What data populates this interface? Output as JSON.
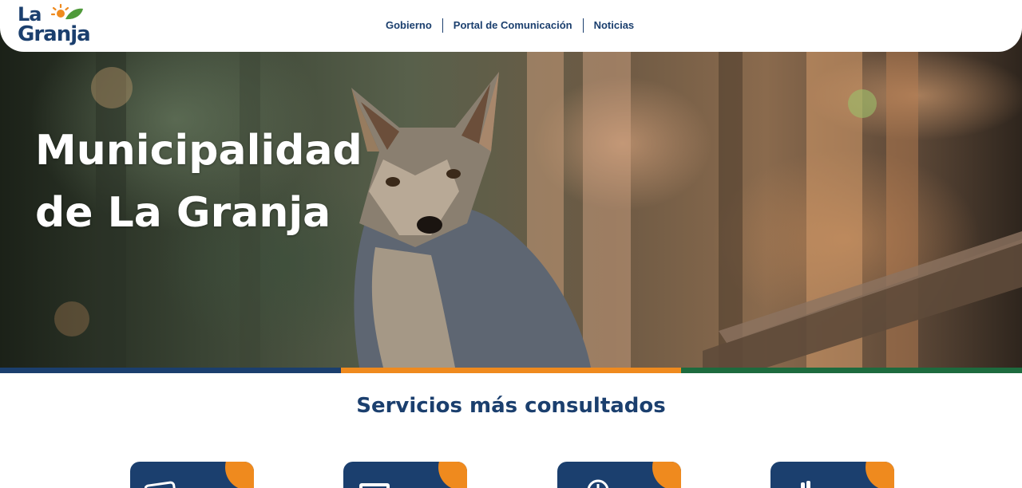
{
  "header": {
    "logo": {
      "line1": "La",
      "line2": "Granja"
    },
    "nav": [
      {
        "label": "Gobierno"
      },
      {
        "label": "Portal de Comunicación"
      },
      {
        "label": "Noticias"
      }
    ]
  },
  "hero": {
    "title_line1": "Municipalidad",
    "title_line2": "de La Granja",
    "image": "fox-in-forest"
  },
  "band_colors": [
    "#1b3f6e",
    "#ef8a1e",
    "#1d6b3e"
  ],
  "services": {
    "title": "Servicios más consultados",
    "cards": [
      {
        "icon": "card-icon"
      },
      {
        "icon": "screen-icon"
      },
      {
        "icon": "clock-icon"
      },
      {
        "icon": "hand-icon"
      }
    ]
  },
  "colors": {
    "brand_blue": "#1b3f6e",
    "brand_orange": "#ef8a1e",
    "brand_green": "#1d6b3e"
  }
}
